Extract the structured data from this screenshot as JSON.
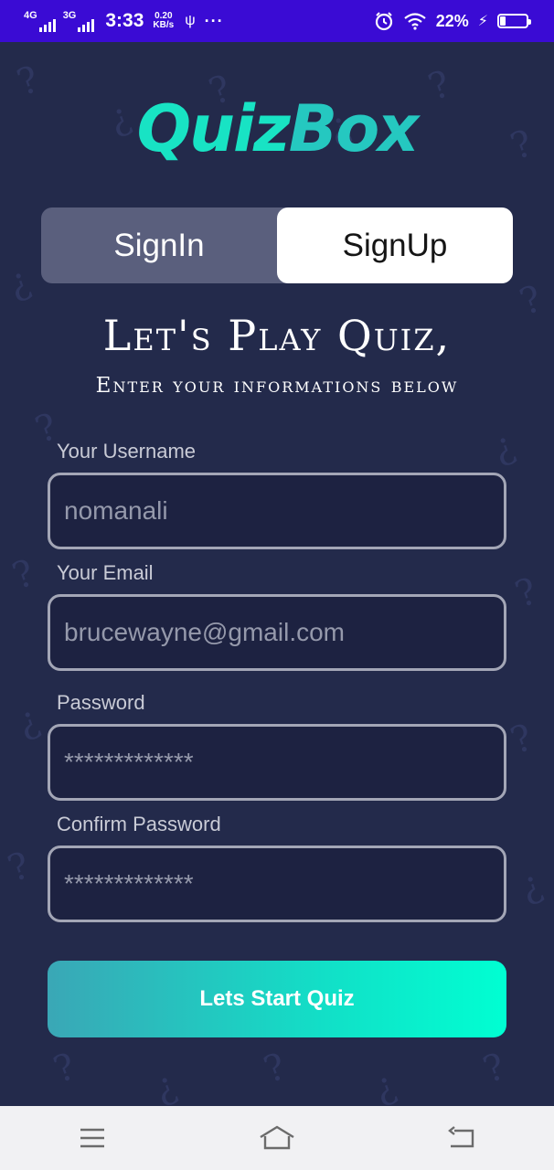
{
  "status_bar": {
    "network1": "4G",
    "network2": "3G",
    "time": "3:33",
    "speed_value": "0.20",
    "speed_unit": "KB/s",
    "usb_icon": "usb-icon",
    "more_icon": "more-dots-icon",
    "alarm_icon": "alarm-icon",
    "wifi_icon": "wifi-icon",
    "battery_percent": "22%",
    "battery_level": 0.22,
    "charging_icon": "lightning-icon"
  },
  "app": {
    "logo_part1": "Quiz",
    "logo_part2": "Box"
  },
  "tabs": [
    {
      "label": "SignIn",
      "active": false
    },
    {
      "label": "SignUp",
      "active": true
    }
  ],
  "heading": "Let's Play Quiz,",
  "subheading": "Enter your informations below",
  "form": {
    "username_label": "Your Username",
    "username_value": "nomanali",
    "email_label": "Your Email",
    "email_value": "brucewayne@gmail.com",
    "password_label": "Password",
    "password_value": "*************",
    "confirm_label": "Confirm Password",
    "confirm_value": "*************"
  },
  "cta_label": "Lets Start Quiz",
  "colors": {
    "status_bar": "#3a0bd4",
    "background": "#232a4b",
    "accent": "#18e3c4"
  },
  "navbar": {
    "menu_icon": "menu-icon",
    "home_icon": "home-icon",
    "back_icon": "back-icon"
  }
}
